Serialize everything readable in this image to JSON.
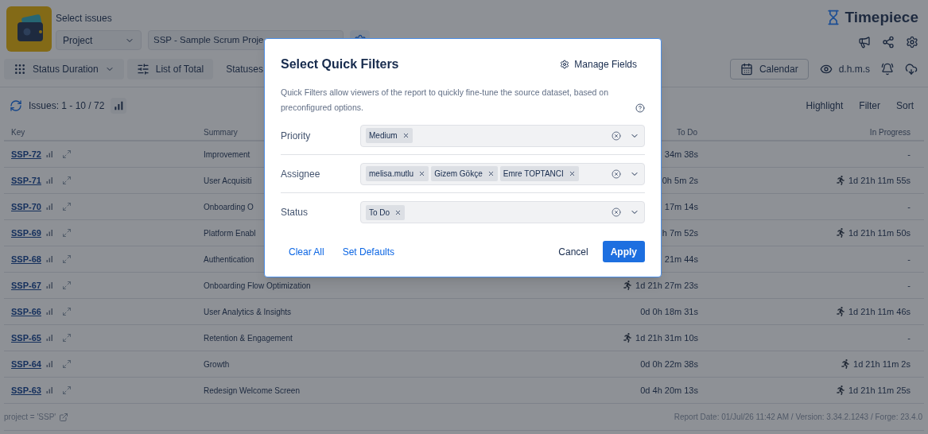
{
  "header": {
    "title": "Select issues",
    "project_type": "Project",
    "project": "SSP - Sample Scrum Proje",
    "brand": "Timepiece"
  },
  "toolbar": {
    "report_type": "Status Duration",
    "view": "List of Total",
    "statuses": "Statuses",
    "calendar": "Calendar",
    "time_format": "d.h.m.s"
  },
  "issues_bar": {
    "count": "Issues: 1 - 10 / 72",
    "actions": [
      "Highlight",
      "Filter",
      "Sort"
    ]
  },
  "table": {
    "columns": [
      "Key",
      "Summary",
      "To Do",
      "In Progress"
    ],
    "rows": [
      {
        "key": "SSP-72",
        "summary": "Improvement",
        "todo": {
          "text": "34m 38s",
          "running": false
        },
        "in_progress": {
          "text": "-",
          "running": false
        }
      },
      {
        "key": "SSP-71",
        "summary": "User Acquisiti",
        "todo": {
          "text": "0h 5m 2s",
          "running": false
        },
        "in_progress": {
          "text": "1d 21h 11m 55s",
          "running": true
        }
      },
      {
        "key": "SSP-70",
        "summary": "Onboarding O",
        "todo": {
          "text": "17m 14s",
          "running": false
        },
        "in_progress": {
          "text": "-",
          "running": false
        }
      },
      {
        "key": "SSP-69",
        "summary": "Platform Enabl",
        "todo": {
          "text": "h 7m 52s",
          "running": false
        },
        "in_progress": {
          "text": "1d 21h 11m 50s",
          "running": true
        }
      },
      {
        "key": "SSP-68",
        "summary": "Authentication",
        "todo": {
          "text": "21m 44s",
          "running": false
        },
        "in_progress": {
          "text": "-",
          "running": false
        }
      },
      {
        "key": "SSP-67",
        "summary": "Onboarding Flow Optimization",
        "todo": {
          "text": "1d 21h 27m 23s",
          "running": true
        },
        "in_progress": {
          "text": "-",
          "running": false
        }
      },
      {
        "key": "SSP-66",
        "summary": "User Analytics & Insights",
        "todo": {
          "text": "0d 0h 18m 31s",
          "running": false
        },
        "in_progress": {
          "text": "1d 21h 11m 46s",
          "running": true
        }
      },
      {
        "key": "SSP-65",
        "summary": "Retention & Engagement",
        "todo": {
          "text": "1d 21h 31m 10s",
          "running": true
        },
        "in_progress": {
          "text": "-",
          "running": false
        }
      },
      {
        "key": "SSP-64",
        "summary": "Growth",
        "todo": {
          "text": "0d 0h 22m 38s",
          "running": false
        },
        "in_progress": {
          "text": "1d 21h 11m 2s",
          "running": true
        }
      },
      {
        "key": "SSP-63",
        "summary": "Redesign Welcome Screen",
        "todo": {
          "text": "0d 4h 20m 13s",
          "running": false
        },
        "in_progress": {
          "text": "1d 21h 11m 25s",
          "running": true
        }
      }
    ]
  },
  "footer": {
    "query": "project = 'SSP'",
    "report_info": "Report Date: 01/Jul/26 11:42 AM / Version: 3.34.2.1243 / Forge: 23.4.0"
  },
  "dialog": {
    "title": "Select Quick Filters",
    "manage_fields": "Manage Fields",
    "description": "Quick Filters allow viewers of the report to quickly fine-tune the source dataset, based on preconfigured options.",
    "filters": [
      {
        "label": "Priority",
        "values": [
          "Medium"
        ]
      },
      {
        "label": "Assignee",
        "values": [
          "melisa.mutlu",
          "Gizem Gökçe",
          "Emre TOPTANCI"
        ]
      },
      {
        "label": "Status",
        "values": [
          "To Do"
        ]
      }
    ],
    "clear_all": "Clear All",
    "set_defaults": "Set Defaults",
    "cancel": "Cancel",
    "apply": "Apply"
  }
}
